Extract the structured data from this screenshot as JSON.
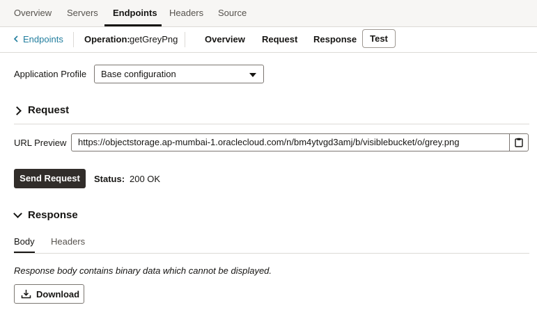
{
  "top_tabs": [
    "Overview",
    "Servers",
    "Endpoints",
    "Headers",
    "Source"
  ],
  "active_top_tab": "Endpoints",
  "sub_nav": {
    "back_label": "Endpoints",
    "operation_label": "Operation:",
    "operation_value": "getGreyPng",
    "tabs": [
      "Overview",
      "Request",
      "Response",
      "Test"
    ],
    "active_tab": "Test"
  },
  "form": {
    "app_profile_label": "Application Profile",
    "app_profile_value": "Base configuration",
    "request_section": "Request",
    "url_label": "URL Preview",
    "url_value": "https://objectstorage.ap-mumbai-1.oraclecloud.com/n/bm4ytvgd3amj/b/visiblebucket/o/grey.png",
    "send_button": "Send Request",
    "status_label": "Status:",
    "status_value": "200 OK"
  },
  "response": {
    "section": "Response",
    "tabs": [
      "Body",
      "Headers"
    ],
    "active_tab": "Body",
    "body_message": "Response body contains binary data which cannot be displayed.",
    "download_button": "Download"
  },
  "icons": {
    "back": "chevron-left-icon",
    "request_toggle": "chevron-right-icon",
    "response_toggle": "chevron-down-icon",
    "copy": "clipboard-icon",
    "download": "download-icon"
  },
  "colors": {
    "link": "#227e9e",
    "primary_button": "#312d2a",
    "top_bar_bg": "#f7f6f4"
  }
}
